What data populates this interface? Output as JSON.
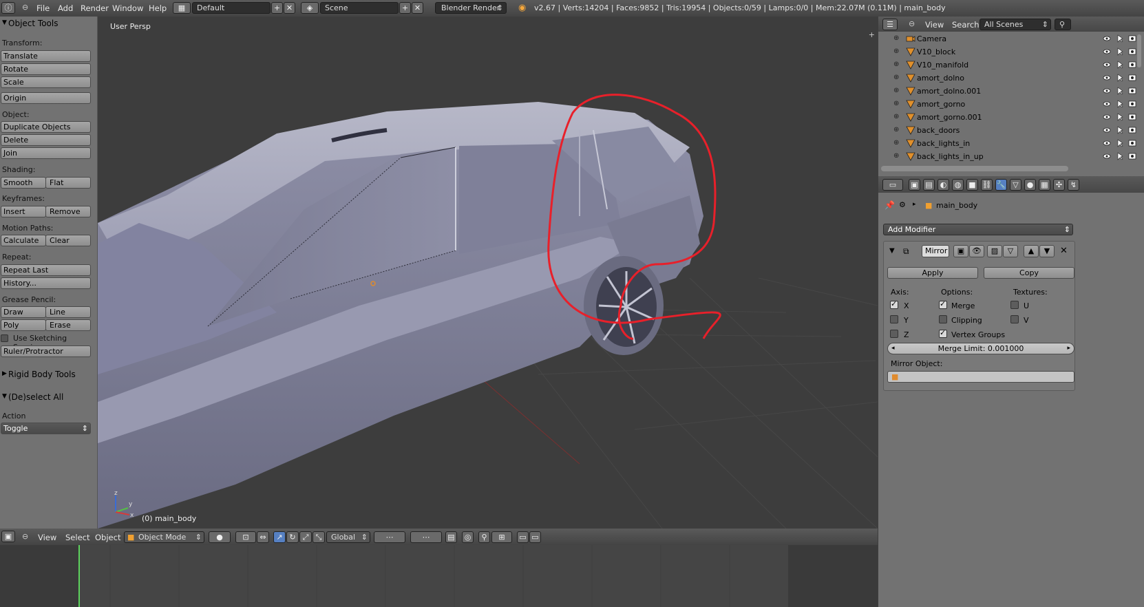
{
  "topbar": {
    "menus": [
      "File",
      "Add",
      "Render",
      "Window",
      "Help"
    ],
    "layout": "Default",
    "scene": "Scene",
    "engine": "Blender Render",
    "stats": "v2.67 | Verts:14204 | Faces:9852 | Tris:19954 | Objects:0/59 | Lamps:0/0 | Mem:22.07M (0.11M) | main_body"
  },
  "tools": {
    "header": "Object Tools",
    "transform_label": "Transform:",
    "translate": "Translate",
    "rotate": "Rotate",
    "scale": "Scale",
    "origin": "Origin",
    "object_label": "Object:",
    "duplicate": "Duplicate Objects",
    "delete": "Delete",
    "join": "Join",
    "shading_label": "Shading:",
    "smooth": "Smooth",
    "flat": "Flat",
    "keyframes_label": "Keyframes:",
    "insert": "Insert",
    "remove": "Remove",
    "motion_label": "Motion Paths:",
    "calculate": "Calculate",
    "clear": "Clear",
    "repeat_label": "Repeat:",
    "repeat_last": "Repeat Last",
    "history": "History...",
    "grease_label": "Grease Pencil:",
    "draw": "Draw",
    "line": "Line",
    "poly": "Poly",
    "erase": "Erase",
    "sketching": "Use Sketching Sessions",
    "ruler": "Ruler/Protractor",
    "rigid_header": "Rigid Body Tools",
    "deselect_header": "(De)select All",
    "action_label": "Action",
    "action_value": "Toggle"
  },
  "viewport": {
    "label": "User Persp",
    "object": "(0) main_body",
    "axis_x": "x",
    "axis_y": "y",
    "axis_z": "z"
  },
  "vpheader": {
    "menus": [
      "View",
      "Select",
      "Object"
    ],
    "mode": "Object Mode",
    "orientation": "Global"
  },
  "outliner": {
    "menus": [
      "View",
      "Search"
    ],
    "scenes": "All Scenes",
    "items": [
      "Camera",
      "V10_block",
      "V10_manifold",
      "amort_dolno",
      "amort_dolno.001",
      "amort_gorno",
      "amort_gorno.001",
      "back_doors",
      "back_lights_in",
      "back_lights_in_up"
    ]
  },
  "properties": {
    "object": "main_body",
    "add_modifier": "Add Modifier",
    "modifier_name": "Mirror",
    "apply": "Apply",
    "copy": "Copy",
    "axis_label": "Axis:",
    "options_label": "Options:",
    "textures_label": "Textures:",
    "x": "X",
    "y": "Y",
    "z": "Z",
    "merge": "Merge",
    "clipping": "Clipping",
    "vertex_groups": "Vertex Groups",
    "u": "U",
    "v": "V",
    "merge_limit": "Merge Limit: 0.001000",
    "mirror_object": "Mirror Object:"
  },
  "colors": {
    "annotation": "#e8202a",
    "active_tab": "#5680c2",
    "frame_marker": "#5dd35d"
  }
}
